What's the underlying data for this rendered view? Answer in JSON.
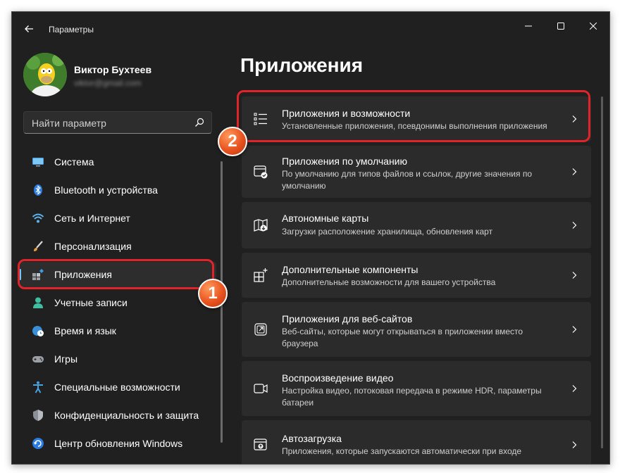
{
  "window": {
    "title": "Параметры"
  },
  "user": {
    "name": "Виктор Бухтеев",
    "email": "viktor@gmail.com"
  },
  "search": {
    "placeholder": "Найти параметр"
  },
  "nav": {
    "items": [
      {
        "label": "Система",
        "icon": "monitor-icon"
      },
      {
        "label": "Bluetooth и устройства",
        "icon": "bluetooth-icon"
      },
      {
        "label": "Сеть и Интернет",
        "icon": "wifi-icon"
      },
      {
        "label": "Персонализация",
        "icon": "brush-icon"
      },
      {
        "label": "Приложения",
        "icon": "apps-icon"
      },
      {
        "label": "Учетные записи",
        "icon": "person-icon"
      },
      {
        "label": "Время и язык",
        "icon": "globe-clock-icon"
      },
      {
        "label": "Игры",
        "icon": "gamepad-icon"
      },
      {
        "label": "Специальные возможности",
        "icon": "accessibility-icon"
      },
      {
        "label": "Конфиденциальность и защита",
        "icon": "shield-icon"
      },
      {
        "label": "Центр обновления Windows",
        "icon": "update-icon"
      }
    ],
    "active": "Приложения"
  },
  "main": {
    "title": "Приложения",
    "cards": [
      {
        "title": "Приложения и возможности",
        "desc": "Установленные приложения, псевдонимы выполнения приложения",
        "icon": "list-icon"
      },
      {
        "title": "Приложения по умолчанию",
        "desc": "По умолчанию для типов файлов и ссылок, другие значения по умолчанию",
        "icon": "default-apps-icon"
      },
      {
        "title": "Автономные карты",
        "desc": "Загрузки расположение хранилища, обновления карт",
        "icon": "map-download-icon"
      },
      {
        "title": "Дополнительные компоненты",
        "desc": "Дополнительные возможности для вашего устройства",
        "icon": "grid-plus-icon"
      },
      {
        "title": "Приложения для веб-сайтов",
        "desc": "Веб-сайты, которые могут открываться в приложении вместо браузера",
        "icon": "open-link-icon"
      },
      {
        "title": "Воспроизведение видео",
        "desc": "Настройка видео, потоковая передача в режиме HDR, параметры батареи",
        "icon": "video-icon"
      },
      {
        "title": "Автозагрузка",
        "desc": "Приложения, которые запускаются автоматически при входе",
        "icon": "startup-icon"
      }
    ]
  },
  "annotations": {
    "badge1": "1",
    "badge2": "2"
  },
  "colors": {
    "accent": "#60cdff",
    "highlight": "#e0242a",
    "badge": "#e8531f",
    "background": "#202020",
    "card": "#2b2b2b"
  }
}
